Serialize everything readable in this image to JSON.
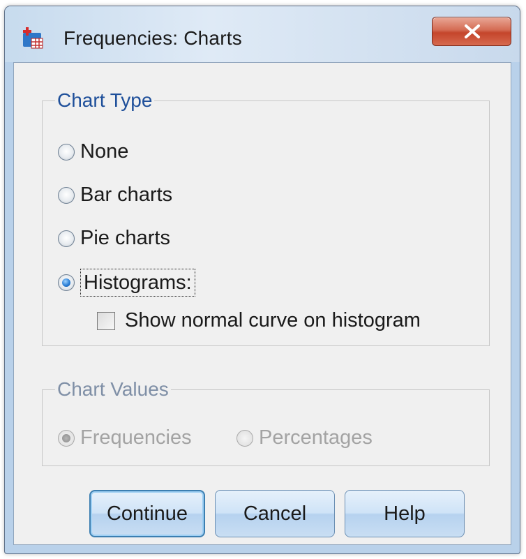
{
  "window": {
    "title": "Frequencies: Charts",
    "close_icon": "close-x-icon",
    "app_icon": "spss-table-icon"
  },
  "chart_type": {
    "legend": "Chart Type",
    "options": [
      {
        "label": "None",
        "checked": false
      },
      {
        "label": "Bar charts",
        "checked": false
      },
      {
        "label": "Pie charts",
        "checked": false
      },
      {
        "label": "Histograms:",
        "checked": true
      }
    ],
    "show_normal_curve": {
      "label": "Show normal curve on histogram",
      "checked": false
    }
  },
  "chart_values": {
    "legend": "Chart Values",
    "enabled": false,
    "options": [
      {
        "label": "Frequencies",
        "checked": true
      },
      {
        "label": "Percentages",
        "checked": false
      }
    ]
  },
  "buttons": {
    "continue": "Continue",
    "cancel": "Cancel",
    "help": "Help"
  }
}
